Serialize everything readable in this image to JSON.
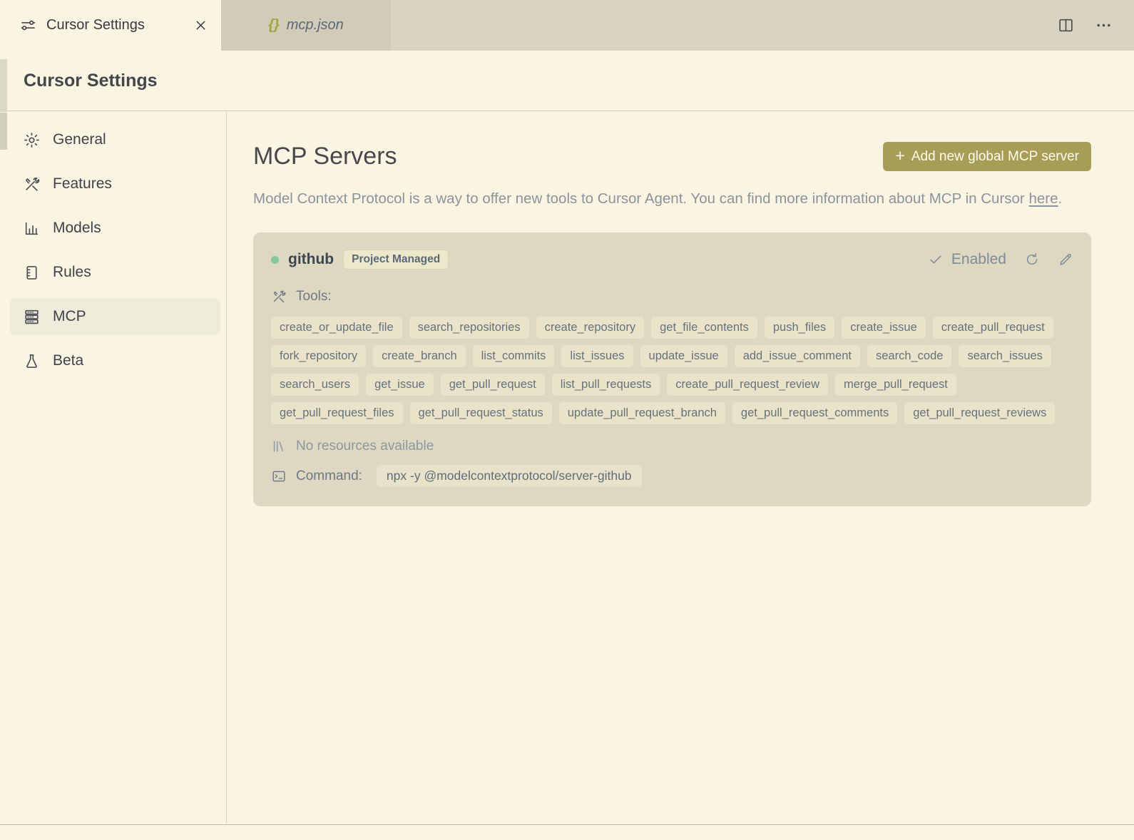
{
  "tabs": {
    "active": {
      "label": "Cursor Settings"
    },
    "preview": {
      "icon_text": "{}",
      "label": "mcp.json"
    }
  },
  "header": {
    "title": "Cursor Settings"
  },
  "sidebar": {
    "items": [
      {
        "label": "General"
      },
      {
        "label": "Features"
      },
      {
        "label": "Models"
      },
      {
        "label": "Rules"
      },
      {
        "label": "MCP",
        "selected": true
      },
      {
        "label": "Beta"
      }
    ]
  },
  "main": {
    "title": "MCP Servers",
    "add_button": {
      "plus": "+",
      "label": "Add new global MCP server"
    },
    "description": {
      "before_link": "Model Context Protocol is a way to offer new tools to Cursor Agent. You can find more information about MCP in Cursor ",
      "link": "here",
      "after_link": "."
    }
  },
  "server": {
    "name": "github",
    "badge": "Project Managed",
    "status": "Enabled",
    "tools_label": "Tools:",
    "tools": [
      "create_or_update_file",
      "search_repositories",
      "create_repository",
      "get_file_contents",
      "push_files",
      "create_issue",
      "create_pull_request",
      "fork_repository",
      "create_branch",
      "list_commits",
      "list_issues",
      "update_issue",
      "add_issue_comment",
      "search_code",
      "search_issues",
      "search_users",
      "get_issue",
      "get_pull_request",
      "list_pull_requests",
      "create_pull_request_review",
      "merge_pull_request",
      "get_pull_request_files",
      "get_pull_request_status",
      "update_pull_request_branch",
      "get_pull_request_comments",
      "get_pull_request_reviews"
    ],
    "resources_text": "No resources available",
    "command_label": "Command:",
    "command": "npx -y @modelcontextprotocol/server-github"
  },
  "colors": {
    "bg_cream": "#faf4e2",
    "tab_bar_bg": "#d8d3c2",
    "card_bg": "#ded8c3",
    "tag_bg": "#eae3c9",
    "accent_olive": "#a89d56",
    "status_green": "#84c89c"
  }
}
